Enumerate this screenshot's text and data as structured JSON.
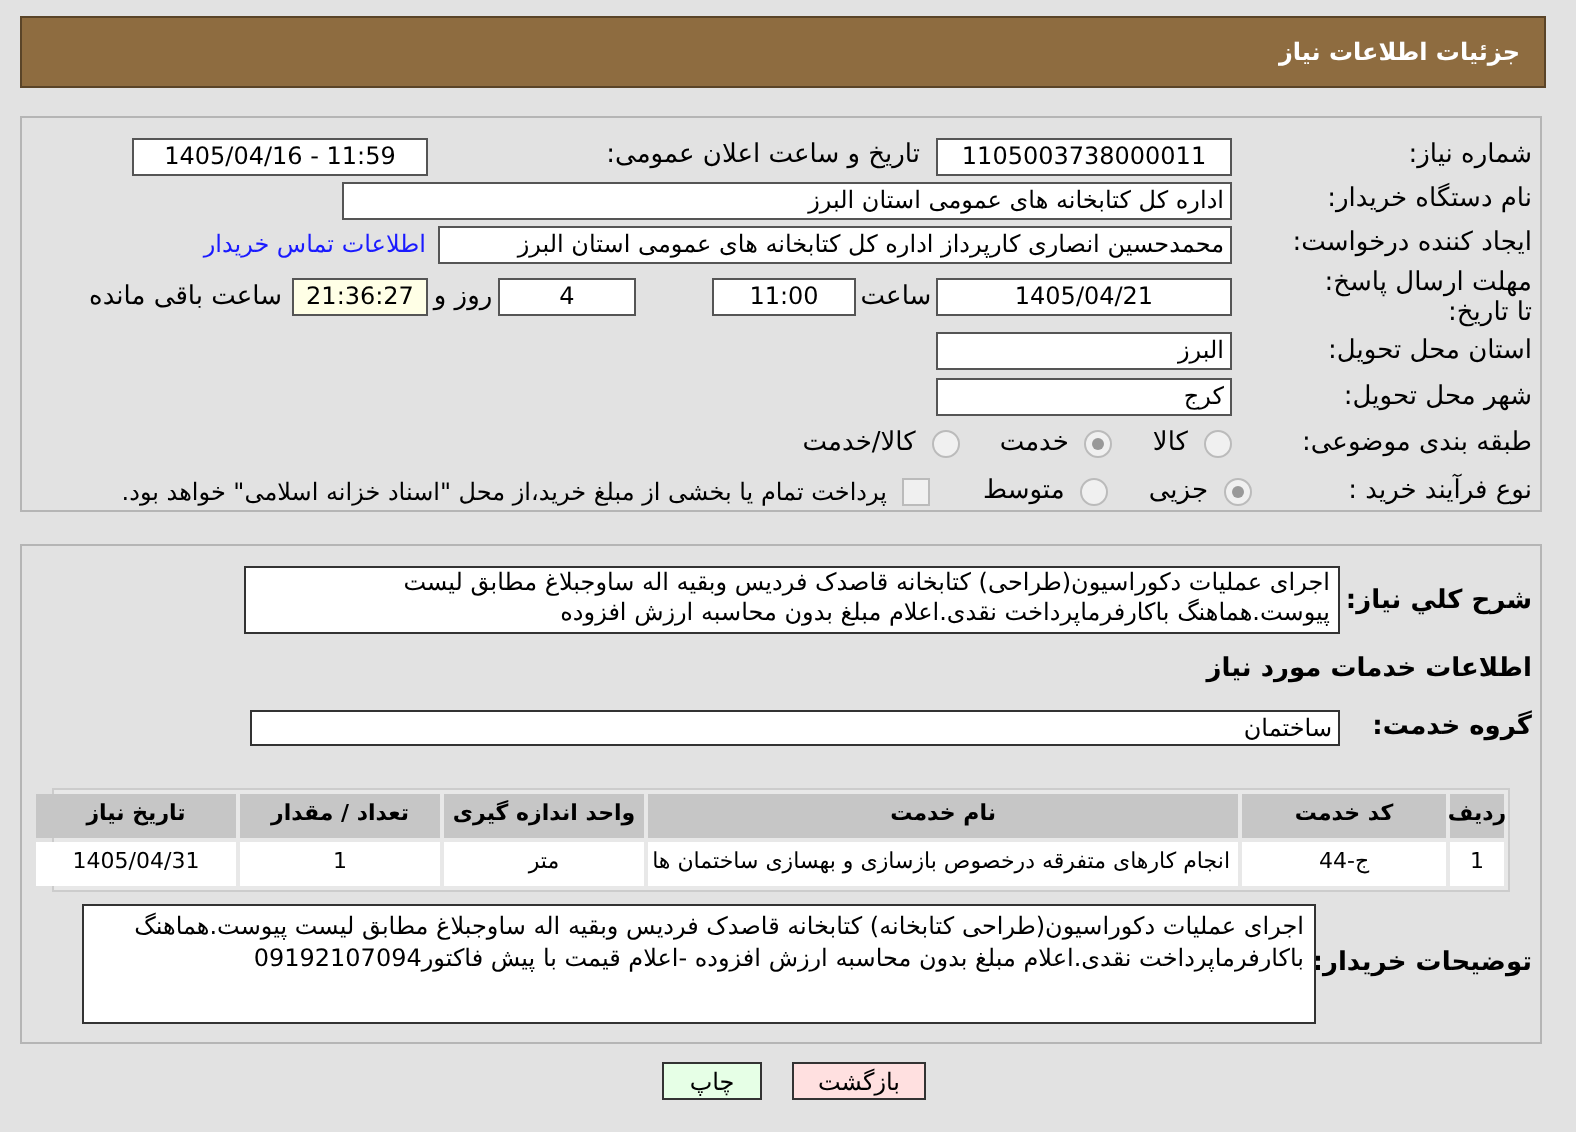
{
  "header": {
    "title": "جزئیات اطلاعات نیاز"
  },
  "need_number": {
    "label": "شماره نیاز:",
    "value": "1105003738000011"
  },
  "announce": {
    "label": "تاریخ و ساعت اعلان عمومی:",
    "value": "1405/04/16 - 11:59"
  },
  "buyer": {
    "label": "نام دستگاه خریدار:",
    "value": "اداره کل کتابخانه های عمومی استان البرز"
  },
  "requester": {
    "label": "ایجاد کننده درخواست:",
    "value": "محمدحسین انصاری کارپرداز اداره کل کتابخانه های عمومی استان البرز",
    "link": "اطلاعات تماس خریدار"
  },
  "deadline": {
    "label": "مهلت ارسال پاسخ: تا تاریخ:",
    "date": "1405/04/21",
    "time_label": "ساعت",
    "time": "11:00",
    "days": "4",
    "days_label": "روز و",
    "remaining": "21:36:27",
    "remaining_label": "ساعت باقی مانده"
  },
  "province": {
    "label": "استان محل تحویل:",
    "value": "البرز"
  },
  "city": {
    "label": "شهر محل تحویل:",
    "value": "کرج"
  },
  "category": {
    "label": "طبقه بندی موضوعی:",
    "options": [
      {
        "label": "کالا",
        "selected": false
      },
      {
        "label": "خدمت",
        "selected": true
      },
      {
        "label": "کالا/خدمت",
        "selected": false
      }
    ]
  },
  "process": {
    "label": "نوع فرآیند خرید :",
    "options": [
      {
        "label": "جزیی",
        "selected": true
      },
      {
        "label": "متوسط",
        "selected": false
      }
    ],
    "payment": {
      "checked": false,
      "text": "پرداخت تمام یا بخشی از مبلغ خرید،از محل \"اسناد خزانه اسلامی\" خواهد بود."
    }
  },
  "description": {
    "label": "شرح کلي نياز:",
    "value": "اجرای عملیات دکوراسیون(طراحی) کتابخانه قاصدک فردیس وبقیه اله ساوجبلاغ مطابق لیست پیوست.هماهنگ باکارفرماپرداخت نقدی.اعلام مبلغ بدون محاسبه ارزش افزوده"
  },
  "services_heading": "اطلاعات خدمات مورد نیاز",
  "service_group": {
    "label": "گروه خدمت:",
    "value": "ساختمان"
  },
  "table": {
    "columns": [
      "ردیف",
      "کد خدمت",
      "نام خدمت",
      "واحد اندازه گیری",
      "تعداد / مقدار",
      "تاریخ نیاز"
    ],
    "rows": [
      [
        "1",
        "ج-44",
        "انجام کارهای متفرقه درخصوص بازسازی و بهسازی ساختمان ها",
        "متر",
        "1",
        "1405/04/31"
      ]
    ]
  },
  "buyer_notes": {
    "label": "توضیحات خریدار:",
    "value": "اجرای عملیات دکوراسیون(طراحی کتابخانه) کتابخانه قاصدک فردیس وبقیه اله ساوجبلاغ مطابق لیست پیوست.هماهنگ باکارفرماپرداخت نقدی.اعلام مبلغ بدون محاسبه ارزش افزوده -اعلام قیمت با پیش فاکتور09192107094"
  },
  "buttons": [
    {
      "label": "بازگشت",
      "kind": "back"
    },
    {
      "label": "چاپ",
      "kind": "print"
    }
  ]
}
